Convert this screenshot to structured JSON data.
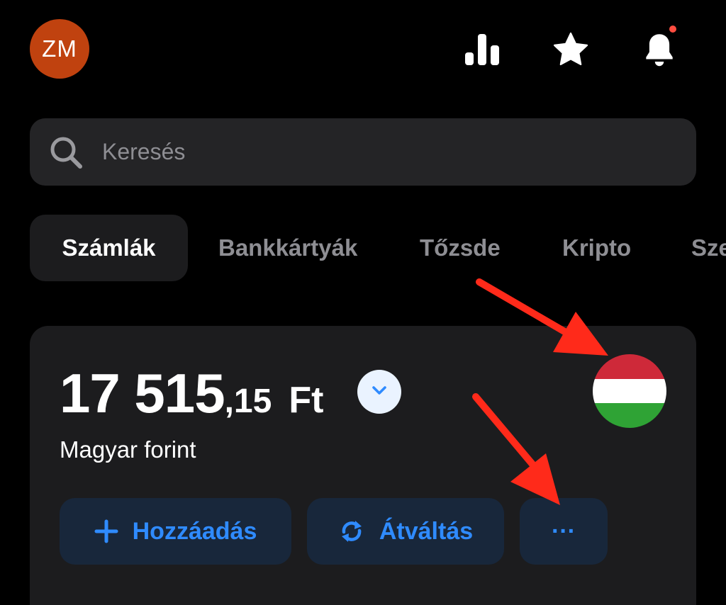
{
  "header": {
    "avatar_initials": "ZM",
    "avatar_color": "#C0420F",
    "icons": [
      "stats-icon",
      "star-icon",
      "bell-icon"
    ],
    "has_notification": true
  },
  "search": {
    "placeholder": "Keresés"
  },
  "tabs": [
    {
      "label": "Számlák",
      "active": true
    },
    {
      "label": "Bankkártyák",
      "active": false
    },
    {
      "label": "Tőzsde",
      "active": false
    },
    {
      "label": "Kripto",
      "active": false
    },
    {
      "label": "Sze",
      "active": false
    }
  ],
  "account": {
    "balance_integer": "17 515",
    "balance_decimal": ",15",
    "currency_symbol": "Ft",
    "currency_name": "Magyar forint",
    "flag_colors": [
      "#CE2939",
      "#FFFFFF",
      "#2FA335"
    ],
    "actions": {
      "add_label": "Hozzáadás",
      "convert_label": "Átváltás",
      "more_label": "···"
    }
  },
  "colors": {
    "accent": "#2F8BFF",
    "annotation_arrow": "#FF2A1A",
    "background": "#000000",
    "surface": "#1C1C1E"
  }
}
